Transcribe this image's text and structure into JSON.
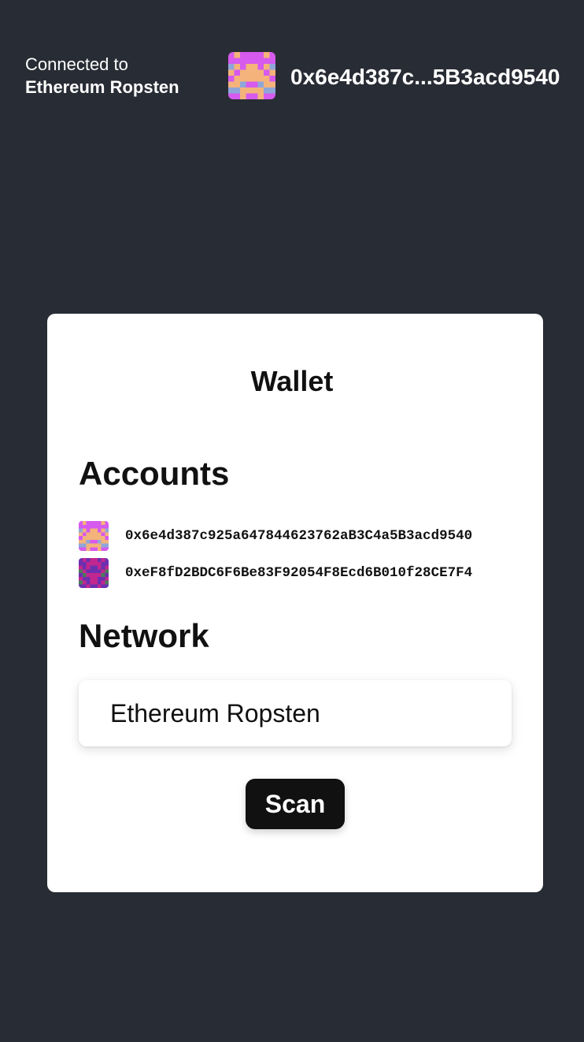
{
  "header": {
    "connected_label": "Connected to",
    "network_name": "Ethereum Ropsten",
    "address_short": "0x6e4d387c...5B3acd9540",
    "avatar_icon": "blockie-avatar-icon"
  },
  "wallet": {
    "title": "Wallet",
    "accounts_heading": "Accounts",
    "accounts": [
      {
        "address": "0x6e4d387c925a647844623762aB3C4a5B3acd9540",
        "avatar_icon": "blockie-avatar-icon"
      },
      {
        "address": "0xeF8fD2BDC6F6Be83F92054F8Ecd6B010f28CE7F4",
        "avatar_icon": "blockie-avatar-icon"
      }
    ],
    "network_heading": "Network",
    "network_selected": "Ethereum Ropsten",
    "scan_label": "Scan"
  },
  "colors": {
    "background": "#282c34",
    "card": "#ffffff",
    "button": "#111111",
    "blockie1_bg": "#d65aee",
    "blockie1_fg": "#f4b37a",
    "blockie1_spot": "#8fa6d9",
    "blockie2_bg": "#6b2fb0",
    "blockie2_fg": "#c2278f",
    "blockie2_spot": "#4a7a5c"
  }
}
